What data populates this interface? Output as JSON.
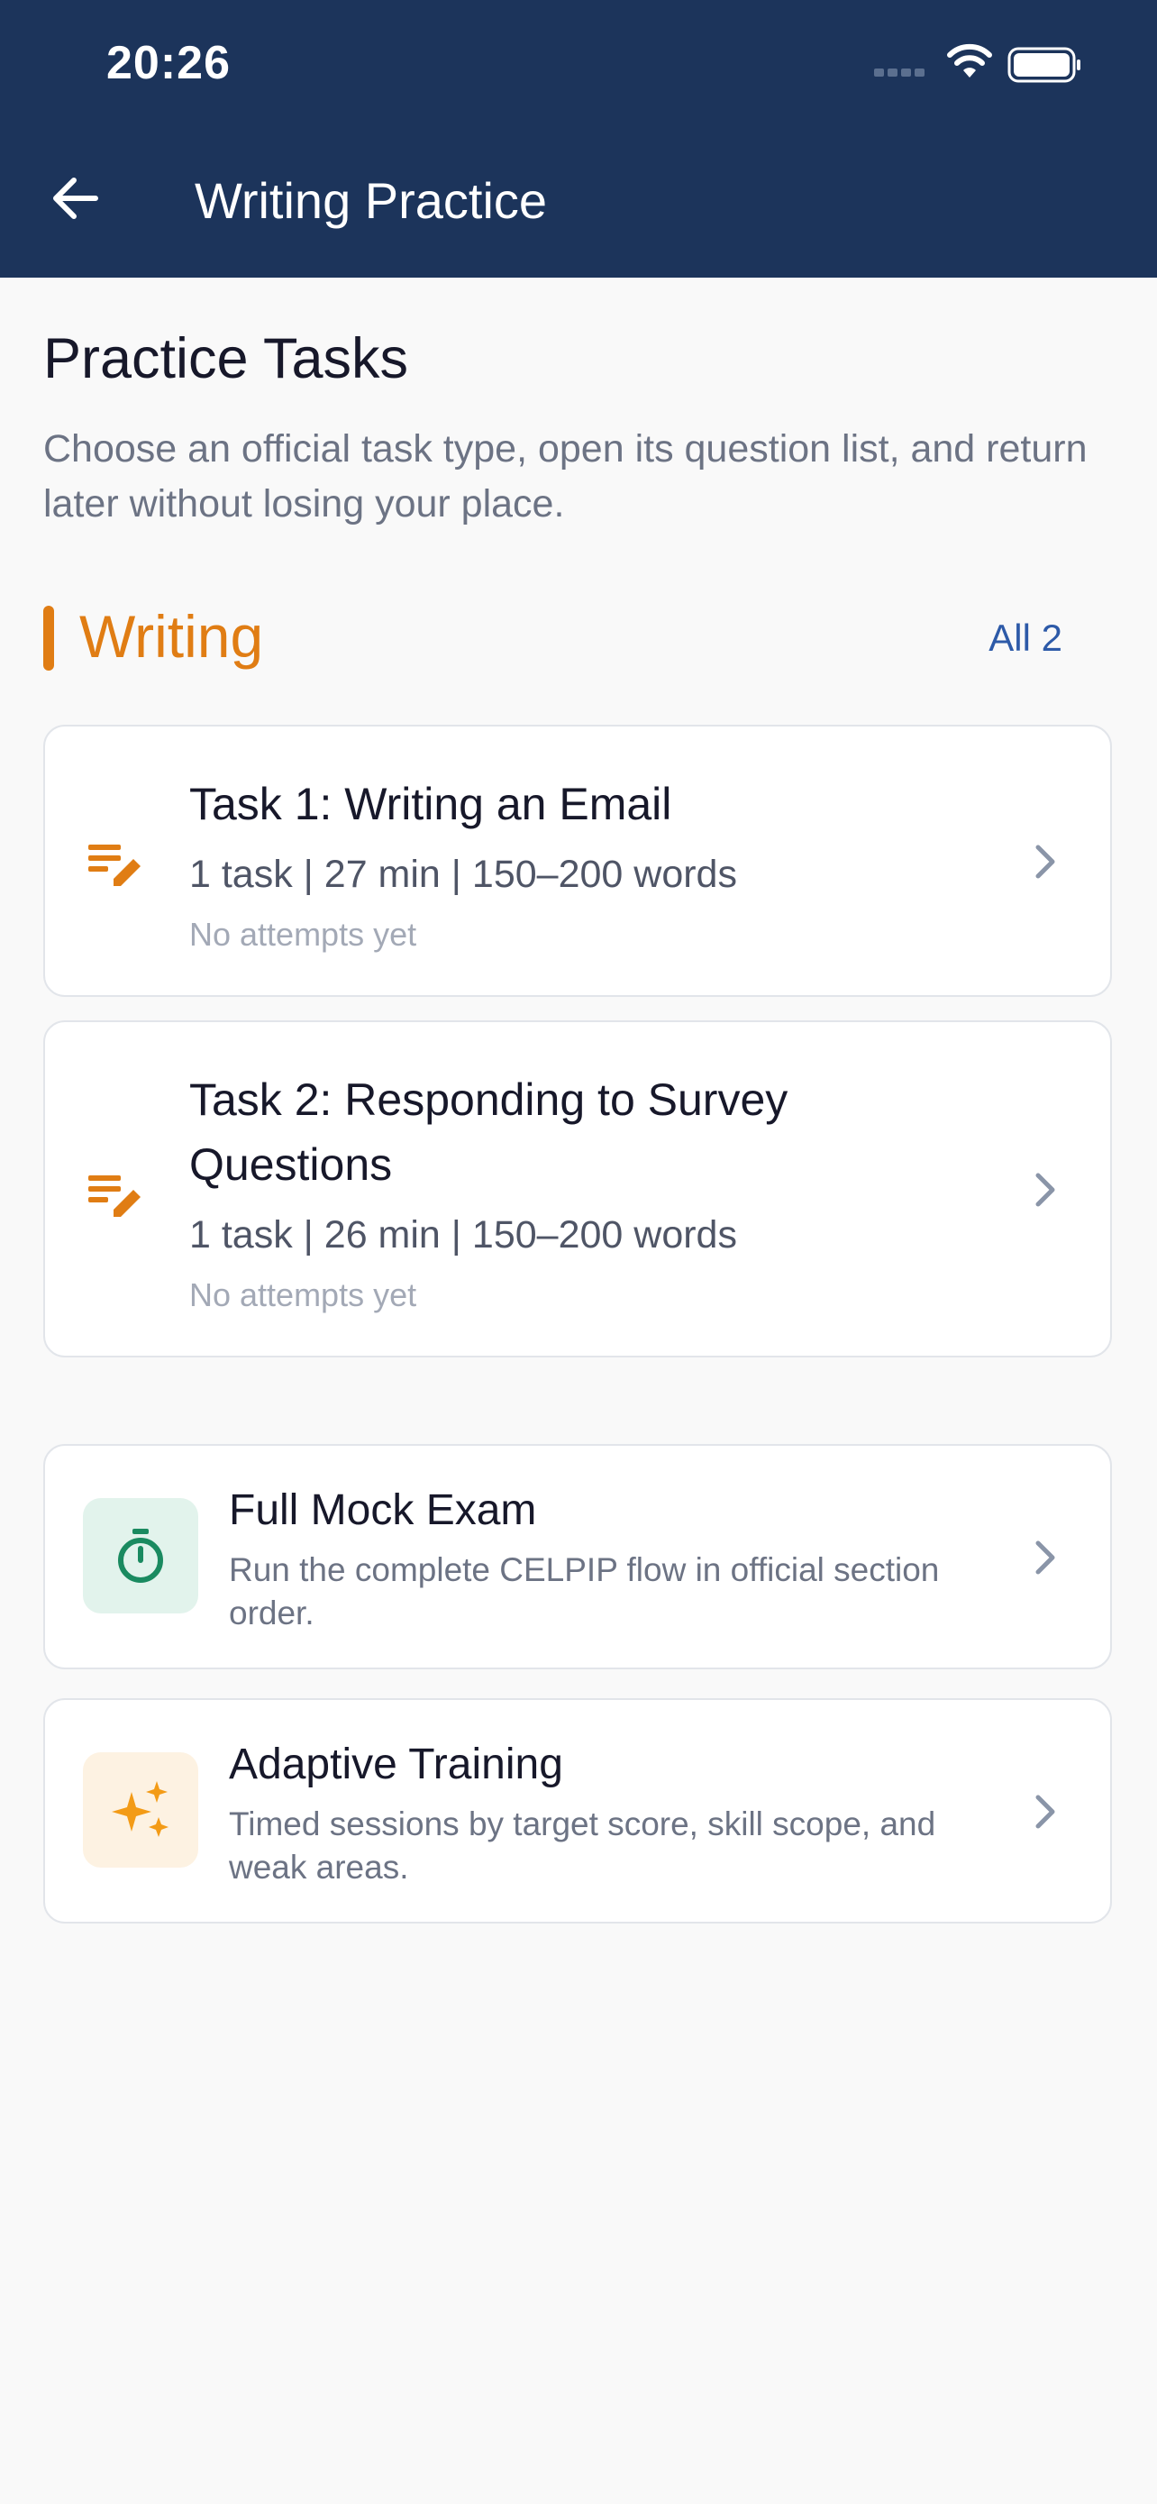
{
  "status_bar": {
    "time": "20:26"
  },
  "header": {
    "title": "Writing Practice"
  },
  "intro": {
    "heading": "Practice Tasks",
    "description": "Choose an official task type, open its question list, and return later without losing your place."
  },
  "category": {
    "title": "Writing",
    "count_label": "All 2"
  },
  "tasks": [
    {
      "title": "Task 1: Writing an Email",
      "meta": "1 task | 27 min | 150–200 words",
      "status": "No attempts yet"
    },
    {
      "title": "Task 2: Responding to Survey Questions",
      "meta": "1 task | 26 min | 150–200 words",
      "status": "No attempts yet"
    }
  ],
  "features": [
    {
      "title": "Full Mock Exam",
      "description": "Run the complete CELPIP flow in official section order.",
      "icon": "timer-icon",
      "accent": "#1a8a60",
      "background": "#e2f3ec"
    },
    {
      "title": "Adaptive Training",
      "description": "Timed sessions by target score, skill scope, and weak areas.",
      "icon": "sparkle-icon",
      "accent": "#f39b16",
      "background": "#fdf2e2"
    }
  ],
  "colors": {
    "header_bg": "#1c345b",
    "accent_orange": "#e07d14",
    "link_blue": "#2d5aa8"
  }
}
